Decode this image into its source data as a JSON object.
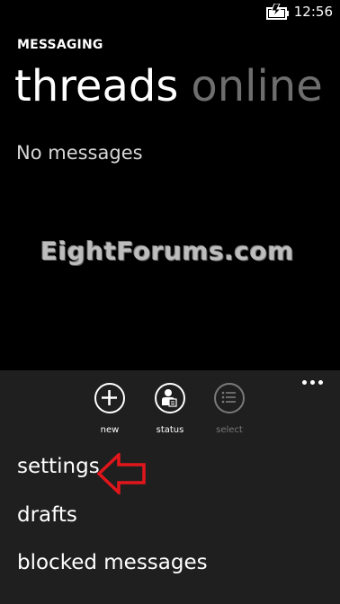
{
  "status_bar": {
    "time": "12:56",
    "icon": "battery-charging-icon"
  },
  "app": {
    "title": "MESSAGING"
  },
  "pivot": {
    "tabs": [
      {
        "label": "threads",
        "active": true
      },
      {
        "label": "online",
        "active": false
      }
    ]
  },
  "content": {
    "empty_text": "No messages"
  },
  "watermark": {
    "text": "EightForums.com"
  },
  "app_bar": {
    "more_icon": "ellipsis-icon",
    "buttons": [
      {
        "label": "new",
        "icon": "add-icon",
        "enabled": true
      },
      {
        "label": "status",
        "icon": "person-status-icon",
        "enabled": true
      },
      {
        "label": "select",
        "icon": "select-list-icon",
        "enabled": false
      }
    ],
    "menu_items": [
      {
        "label": "settings"
      },
      {
        "label": "drafts"
      },
      {
        "label": "blocked messages"
      }
    ]
  },
  "annotation": {
    "arrow_icon": "red-arrow-icon",
    "color": "#e0161b"
  },
  "colors": {
    "background": "#000000",
    "app_bar": "#1f1f1f",
    "inactive_text": "#6e6e6e",
    "disabled": "#7a7a7a"
  }
}
